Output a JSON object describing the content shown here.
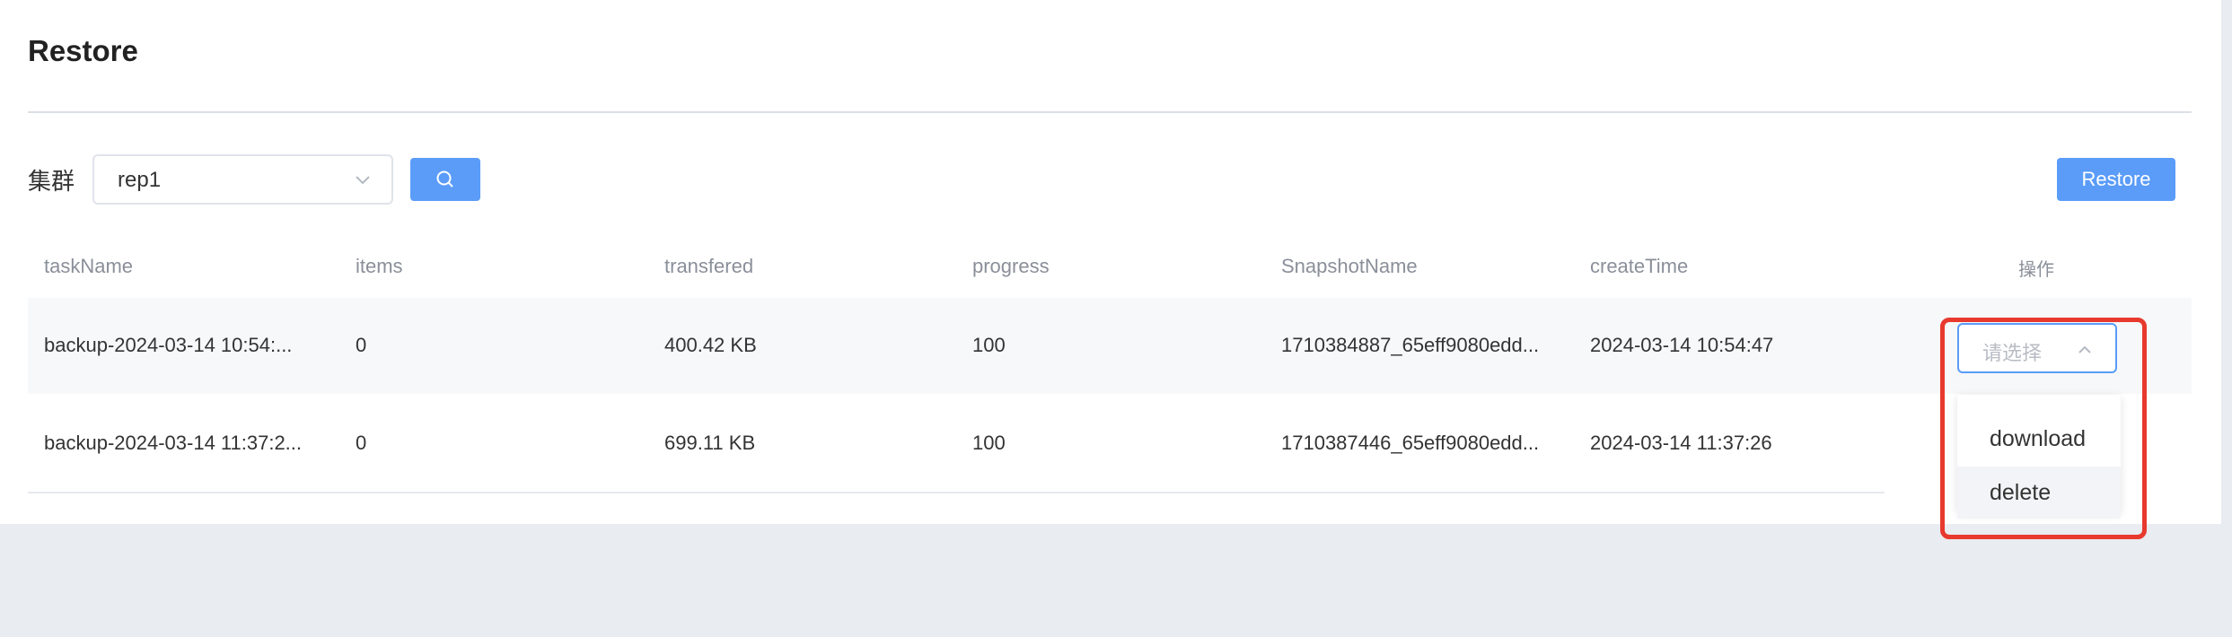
{
  "page": {
    "title": "Restore"
  },
  "filter": {
    "label": "集群",
    "cluster_value": "rep1",
    "search_icon": "search-icon",
    "restore_button_label": "Restore"
  },
  "table": {
    "headers": {
      "taskName": "taskName",
      "items": "items",
      "transfered": "transfered",
      "progress": "progress",
      "snapshotName": "SnapshotName",
      "createTime": "createTime",
      "operation": "操作"
    },
    "rows": [
      {
        "taskName": "backup-2024-03-14 10:54:...",
        "items": "0",
        "transfered": "400.42 KB",
        "progress": "100",
        "snapshotName": "1710384887_65eff9080edd...",
        "createTime": "2024-03-14 10:54:47"
      },
      {
        "taskName": "backup-2024-03-14 11:37:2...",
        "items": "0",
        "transfered": "699.11 KB",
        "progress": "100",
        "snapshotName": "1710387446_65eff9080edd...",
        "createTime": "2024-03-14 11:37:26"
      }
    ]
  },
  "operation": {
    "placeholder": "请选择",
    "options": [
      "download",
      "delete"
    ]
  },
  "colors": {
    "primary": "#5a9cf8",
    "highlight": "#e8392e"
  }
}
